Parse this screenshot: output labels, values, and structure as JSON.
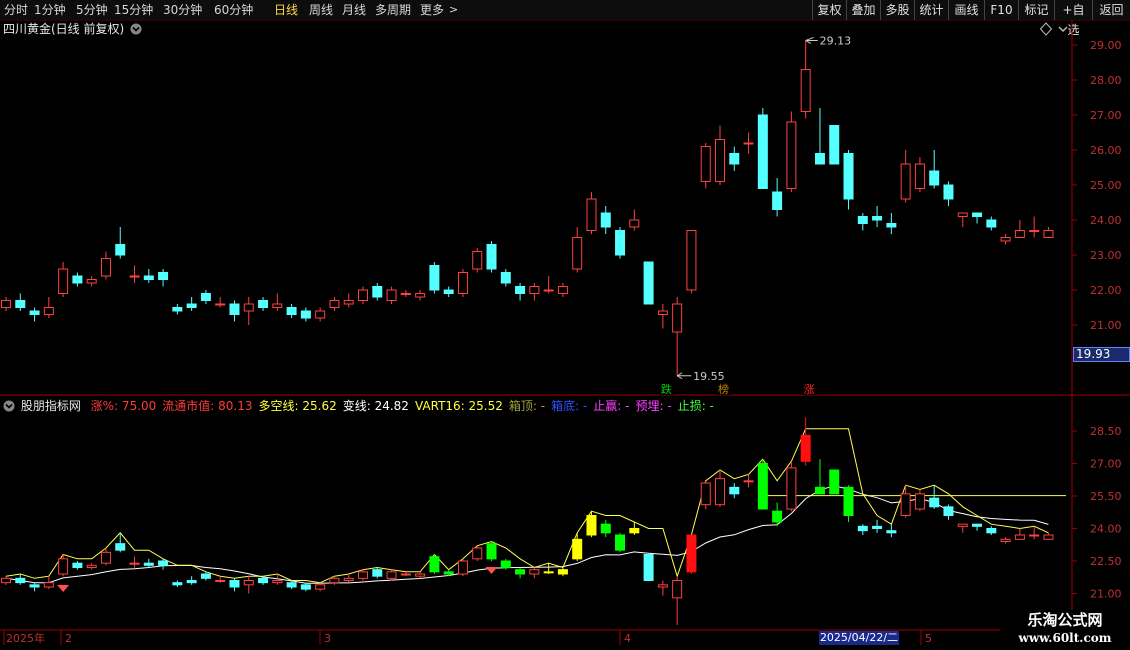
{
  "toolbar": {
    "periods": [
      {
        "label": "分时",
        "active": false
      },
      {
        "label": "1分钟",
        "active": false
      },
      {
        "label": "5分钟",
        "active": false
      },
      {
        "label": "15分钟",
        "active": false
      },
      {
        "label": "30分钟",
        "active": false
      },
      {
        "label": "60分钟",
        "active": false
      },
      {
        "label": "日线",
        "active": true
      },
      {
        "label": "周线",
        "active": false
      },
      {
        "label": "月线",
        "active": false
      },
      {
        "label": "多周期",
        "active": false
      },
      {
        "label": "更多",
        "active": false
      }
    ],
    "right_buttons": [
      "复权",
      "叠加",
      "多股",
      "统计",
      "画线",
      "F10",
      "标记",
      "+自选",
      "返回"
    ]
  },
  "main_chart": {
    "title": "四川黄金(日线 前复权)",
    "price_axis": [
      "29.00",
      "28.00",
      "27.00",
      "26.00",
      "25.00",
      "24.00",
      "23.00",
      "22.00",
      "21.00"
    ],
    "current_price": "19.93",
    "high_label": "29.13",
    "low_label": "19.55",
    "markers": [
      {
        "label": "跌",
        "color": "#00d000"
      },
      {
        "label": "榜",
        "color": "#c08000"
      },
      {
        "label": "涨",
        "color": "#ff2020"
      }
    ]
  },
  "indicator": {
    "name": "股朋指标网",
    "legend": [
      {
        "text": "涨%: 75.00",
        "color": "#ff3b3b"
      },
      {
        "text": "流通市值: 80.13",
        "color": "#ff3b3b"
      },
      {
        "text": "多空线: 25.62",
        "color": "#ffff40"
      },
      {
        "text": "变线: 24.82",
        "color": "#ffffff"
      },
      {
        "text": "VART16: 25.52",
        "color": "#ffff40"
      },
      {
        "text": "箱顶: -",
        "color": "#a0a040"
      },
      {
        "text": "箱底: -",
        "color": "#3050ff"
      },
      {
        "text": "止赢: -",
        "color": "#ff40ff"
      },
      {
        "text": "预埋: -",
        "color": "#ff40ff"
      },
      {
        "text": "止损: -",
        "color": "#40ff40"
      }
    ],
    "axis": [
      "28.50",
      "27.00",
      "25.50",
      "24.00",
      "22.50",
      "21.00"
    ]
  },
  "date_axis": {
    "labels": [
      "2025年",
      "2",
      "3",
      "4",
      "5"
    ],
    "cursor_date": "2025/04/22/二"
  },
  "watermark": {
    "line1": "乐淘公式网",
    "line2": "www.60lt.com"
  },
  "chart_data": {
    "type": "candlestick",
    "title": "四川黄金(日线 前复权)",
    "y_range": [
      20.0,
      29.5
    ],
    "candles": [
      {
        "o": 21.5,
        "c": 21.7,
        "h": 21.8,
        "l": 21.4
      },
      {
        "o": 21.7,
        "c": 21.5,
        "h": 21.9,
        "l": 21.4
      },
      {
        "o": 21.4,
        "c": 21.3,
        "h": 21.5,
        "l": 21.1
      },
      {
        "o": 21.3,
        "c": 21.5,
        "h": 21.8,
        "l": 21.2
      },
      {
        "o": 21.9,
        "c": 22.6,
        "h": 22.8,
        "l": 21.8
      },
      {
        "o": 22.4,
        "c": 22.2,
        "h": 22.5,
        "l": 22.1
      },
      {
        "o": 22.2,
        "c": 22.3,
        "h": 22.4,
        "l": 22.1
      },
      {
        "o": 22.4,
        "c": 22.9,
        "h": 23.1,
        "l": 22.3
      },
      {
        "o": 23.3,
        "c": 23.0,
        "h": 23.8,
        "l": 22.9
      },
      {
        "o": 22.4,
        "c": 22.4,
        "h": 22.7,
        "l": 22.2
      },
      {
        "o": 22.4,
        "c": 22.3,
        "h": 22.6,
        "l": 22.2
      },
      {
        "o": 22.5,
        "c": 22.3,
        "h": 22.6,
        "l": 22.1
      },
      {
        "o": 21.5,
        "c": 21.4,
        "h": 21.6,
        "l": 21.3
      },
      {
        "o": 21.6,
        "c": 21.5,
        "h": 21.8,
        "l": 21.4
      },
      {
        "o": 21.9,
        "c": 21.7,
        "h": 22.0,
        "l": 21.6
      },
      {
        "o": 21.6,
        "c": 21.6,
        "h": 21.8,
        "l": 21.5
      },
      {
        "o": 21.6,
        "c": 21.3,
        "h": 21.7,
        "l": 21.1
      },
      {
        "o": 21.4,
        "c": 21.6,
        "h": 21.8,
        "l": 21.0
      },
      {
        "o": 21.7,
        "c": 21.5,
        "h": 21.8,
        "l": 21.4
      },
      {
        "o": 21.5,
        "c": 21.6,
        "h": 21.9,
        "l": 21.4
      },
      {
        "o": 21.5,
        "c": 21.3,
        "h": 21.6,
        "l": 21.2
      },
      {
        "o": 21.4,
        "c": 21.2,
        "h": 21.5,
        "l": 21.1
      },
      {
        "o": 21.2,
        "c": 21.4,
        "h": 21.5,
        "l": 21.1
      },
      {
        "o": 21.5,
        "c": 21.7,
        "h": 21.8,
        "l": 21.4
      },
      {
        "o": 21.6,
        "c": 21.7,
        "h": 21.9,
        "l": 21.5
      },
      {
        "o": 21.7,
        "c": 22.0,
        "h": 22.1,
        "l": 21.6
      },
      {
        "o": 22.1,
        "c": 21.8,
        "h": 22.2,
        "l": 21.7
      },
      {
        "o": 21.7,
        "c": 22.0,
        "h": 22.1,
        "l": 21.6
      },
      {
        "o": 21.9,
        "c": 21.9,
        "h": 22.0,
        "l": 21.8
      },
      {
        "o": 21.8,
        "c": 21.9,
        "h": 22.0,
        "l": 21.7
      },
      {
        "o": 22.7,
        "c": 22.0,
        "h": 22.8,
        "l": 21.9
      },
      {
        "o": 22.0,
        "c": 21.9,
        "h": 22.1,
        "l": 21.8
      },
      {
        "o": 21.9,
        "c": 22.5,
        "h": 22.6,
        "l": 21.8
      },
      {
        "o": 22.6,
        "c": 23.1,
        "h": 23.2,
        "l": 22.5
      },
      {
        "o": 23.3,
        "c": 22.6,
        "h": 23.4,
        "l": 22.5
      },
      {
        "o": 22.5,
        "c": 22.2,
        "h": 22.6,
        "l": 22.1
      },
      {
        "o": 22.1,
        "c": 21.9,
        "h": 22.2,
        "l": 21.7
      },
      {
        "o": 21.9,
        "c": 22.1,
        "h": 22.2,
        "l": 21.7
      },
      {
        "o": 22.0,
        "c": 22.0,
        "h": 22.4,
        "l": 21.9
      },
      {
        "o": 21.9,
        "c": 22.1,
        "h": 22.2,
        "l": 21.8
      },
      {
        "o": 22.6,
        "c": 23.5,
        "h": 23.8,
        "l": 22.5
      },
      {
        "o": 23.7,
        "c": 24.6,
        "h": 24.8,
        "l": 23.6
      },
      {
        "o": 24.2,
        "c": 23.8,
        "h": 24.4,
        "l": 23.6
      },
      {
        "o": 23.7,
        "c": 23.0,
        "h": 23.8,
        "l": 22.9
      },
      {
        "o": 23.8,
        "c": 24.0,
        "h": 24.3,
        "l": 23.7
      },
      {
        "o": 22.8,
        "c": 21.6,
        "h": 22.8,
        "l": 21.6
      },
      {
        "o": 21.3,
        "c": 21.4,
        "h": 21.6,
        "l": 20.9
      },
      {
        "o": 20.8,
        "c": 21.6,
        "h": 21.8,
        "l": 19.55
      },
      {
        "o": 22.0,
        "c": 23.7,
        "h": 23.7,
        "l": 21.9
      },
      {
        "o": 25.1,
        "c": 26.1,
        "h": 26.2,
        "l": 24.9
      },
      {
        "o": 25.1,
        "c": 26.3,
        "h": 26.7,
        "l": 25.0
      },
      {
        "o": 25.9,
        "c": 25.6,
        "h": 26.1,
        "l": 25.4
      },
      {
        "o": 26.2,
        "c": 26.2,
        "h": 26.5,
        "l": 25.9
      },
      {
        "o": 27.0,
        "c": 24.9,
        "h": 27.2,
        "l": 24.9
      },
      {
        "o": 24.8,
        "c": 24.3,
        "h": 25.2,
        "l": 24.1
      },
      {
        "o": 24.9,
        "c": 26.8,
        "h": 27.1,
        "l": 24.8
      },
      {
        "o": 27.1,
        "c": 28.3,
        "h": 29.13,
        "l": 26.9
      },
      {
        "o": 25.9,
        "c": 25.6,
        "h": 27.2,
        "l": 25.6
      },
      {
        "o": 26.7,
        "c": 25.6,
        "h": 26.7,
        "l": 25.6
      },
      {
        "o": 25.9,
        "c": 24.6,
        "h": 26.0,
        "l": 24.3
      },
      {
        "o": 24.1,
        "c": 23.9,
        "h": 24.2,
        "l": 23.7
      },
      {
        "o": 24.1,
        "c": 24.0,
        "h": 24.4,
        "l": 23.8
      },
      {
        "o": 23.9,
        "c": 23.8,
        "h": 24.2,
        "l": 23.6
      },
      {
        "o": 24.6,
        "c": 25.6,
        "h": 26.0,
        "l": 24.5
      },
      {
        "o": 24.9,
        "c": 25.6,
        "h": 25.8,
        "l": 24.8
      },
      {
        "o": 25.4,
        "c": 25.0,
        "h": 26.0,
        "l": 24.9
      },
      {
        "o": 25.0,
        "c": 24.6,
        "h": 25.1,
        "l": 24.4
      },
      {
        "o": 24.1,
        "c": 24.2,
        "h": 24.2,
        "l": 23.8
      },
      {
        "o": 24.2,
        "c": 24.1,
        "h": 24.2,
        "l": 23.9
      },
      {
        "o": 24.0,
        "c": 23.8,
        "h": 24.1,
        "l": 23.7
      },
      {
        "o": 23.4,
        "c": 23.5,
        "h": 23.6,
        "l": 23.3
      },
      {
        "o": 23.5,
        "c": 23.7,
        "h": 24.0,
        "l": 23.5
      },
      {
        "o": 23.7,
        "c": 23.7,
        "h": 24.1,
        "l": 23.5
      },
      {
        "o": 23.5,
        "c": 23.7,
        "h": 23.8,
        "l": 23.5
      }
    ]
  }
}
